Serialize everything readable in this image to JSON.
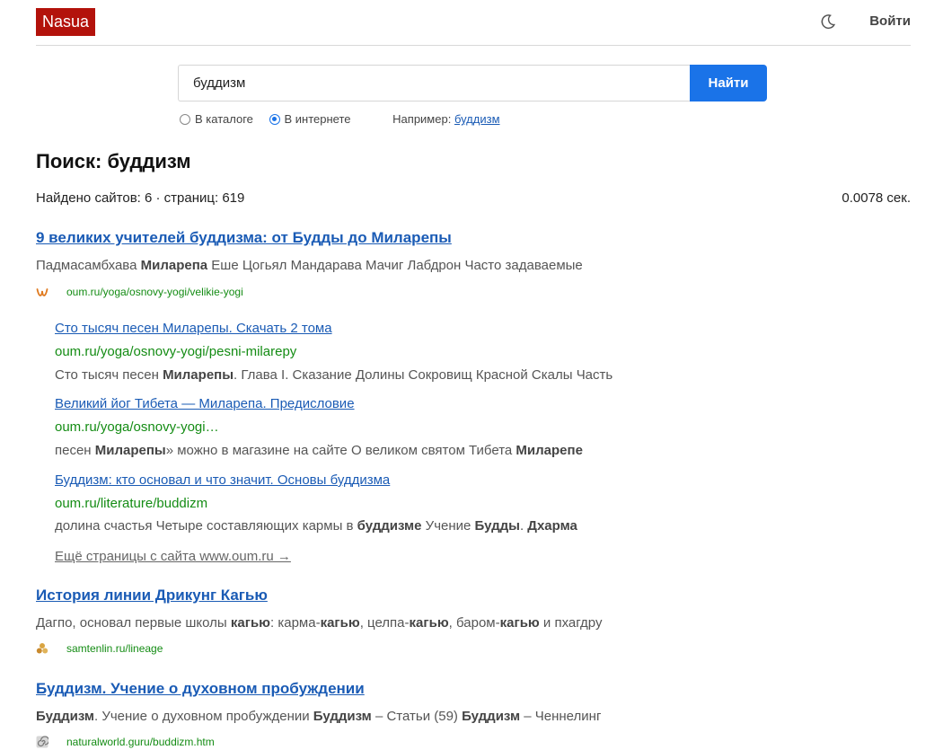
{
  "header": {
    "logo": "Nasua",
    "login": "Войти"
  },
  "search": {
    "query": "буддизм",
    "button": "Найти",
    "option_catalog": "В каталоге",
    "option_web": "В интернете",
    "selected": "В интернете",
    "example_prefix": "Например:",
    "example_link": "буддизм"
  },
  "results_header": {
    "title": "Поиск: буддизм",
    "stats": "Найдено сайтов: 6 · страниц: 619",
    "time": "0.0078 сек."
  },
  "results": [
    {
      "title": "9 великих учителей буддизма: от Будды до Миларепы",
      "snippet": [
        {
          "t": "Падмасамбхава ",
          "b": false
        },
        {
          "t": "Миларепа",
          "b": true
        },
        {
          "t": " Еше Цогьял Мандарава Мачиг Лабдрон Часто задаваемые",
          "b": false
        }
      ],
      "url": "oum.ru/yoga/osnovy-yogi/velikie-yogi",
      "favicon": "oum-logo-icon",
      "subpages": [
        {
          "title": "Сто тысяч песен Миларепы. Скачать 2 тома",
          "url": "oum.ru/yoga/osnovy-yogi/pesni-milarepy",
          "snippet": [
            {
              "t": "Сто тысяч песен ",
              "b": false
            },
            {
              "t": "Миларепы",
              "b": true
            },
            {
              "t": ". Глава I. Сказание Долины Сокровищ Красной Скалы Часть",
              "b": false
            }
          ]
        },
        {
          "title": "Великий йог Тибета — Миларепа. Предисловие",
          "url": "oum.ru/yoga/osnovy-yogi…",
          "snippet": [
            {
              "t": "песен ",
              "b": false
            },
            {
              "t": "Миларепы",
              "b": true
            },
            {
              "t": "» можно в магазине на сайте О великом святом Тибета ",
              "b": false
            },
            {
              "t": "Миларепе",
              "b": true
            }
          ]
        },
        {
          "title": "Буддизм: кто основал и что значит. Основы буддизма",
          "url": "oum.ru/literature/buddizm",
          "snippet": [
            {
              "t": "долина счастья Четыре составляющих кармы в ",
              "b": false
            },
            {
              "t": "буддизме",
              "b": true
            },
            {
              "t": " Учение ",
              "b": false
            },
            {
              "t": "Будды",
              "b": true
            },
            {
              "t": ". ",
              "b": false
            },
            {
              "t": "Дхарма",
              "b": true
            }
          ]
        }
      ],
      "more": "Ещё страницы с сайта www.oum.ru →"
    },
    {
      "title": "История линии Дрикунг Кагью",
      "snippet": [
        {
          "t": "Дагпо, основал первые школы ",
          "b": false
        },
        {
          "t": "кагью",
          "b": true
        },
        {
          "t": ": карма-",
          "b": false
        },
        {
          "t": "кагью",
          "b": true
        },
        {
          "t": ", целпа-",
          "b": false
        },
        {
          "t": "кагью",
          "b": true
        },
        {
          "t": ", баром-",
          "b": false
        },
        {
          "t": "кагью",
          "b": true
        },
        {
          "t": " и пхагдру",
          "b": false
        }
      ],
      "url": "samtenlin.ru/lineage",
      "favicon": "triple-jewel-icon"
    },
    {
      "title": "Буддизм. Учение о духовном пробуждении",
      "snippet": [
        {
          "t": "Буддизм",
          "b": true
        },
        {
          "t": ". Учение о духовном пробуждении ",
          "b": false
        },
        {
          "t": "Буддизм",
          "b": true
        },
        {
          "t": " – Статьи (59) ",
          "b": false
        },
        {
          "t": "Буддизм",
          "b": true
        },
        {
          "t": " – Ченнелинг",
          "b": false
        }
      ],
      "url": "naturalworld.guru/buddizm.htm",
      "favicon": "spiral-icon"
    }
  ],
  "colors": {
    "brand": "#b3120b",
    "button": "#1a73e8",
    "link": "#1a5bb5",
    "url": "#148c14"
  }
}
